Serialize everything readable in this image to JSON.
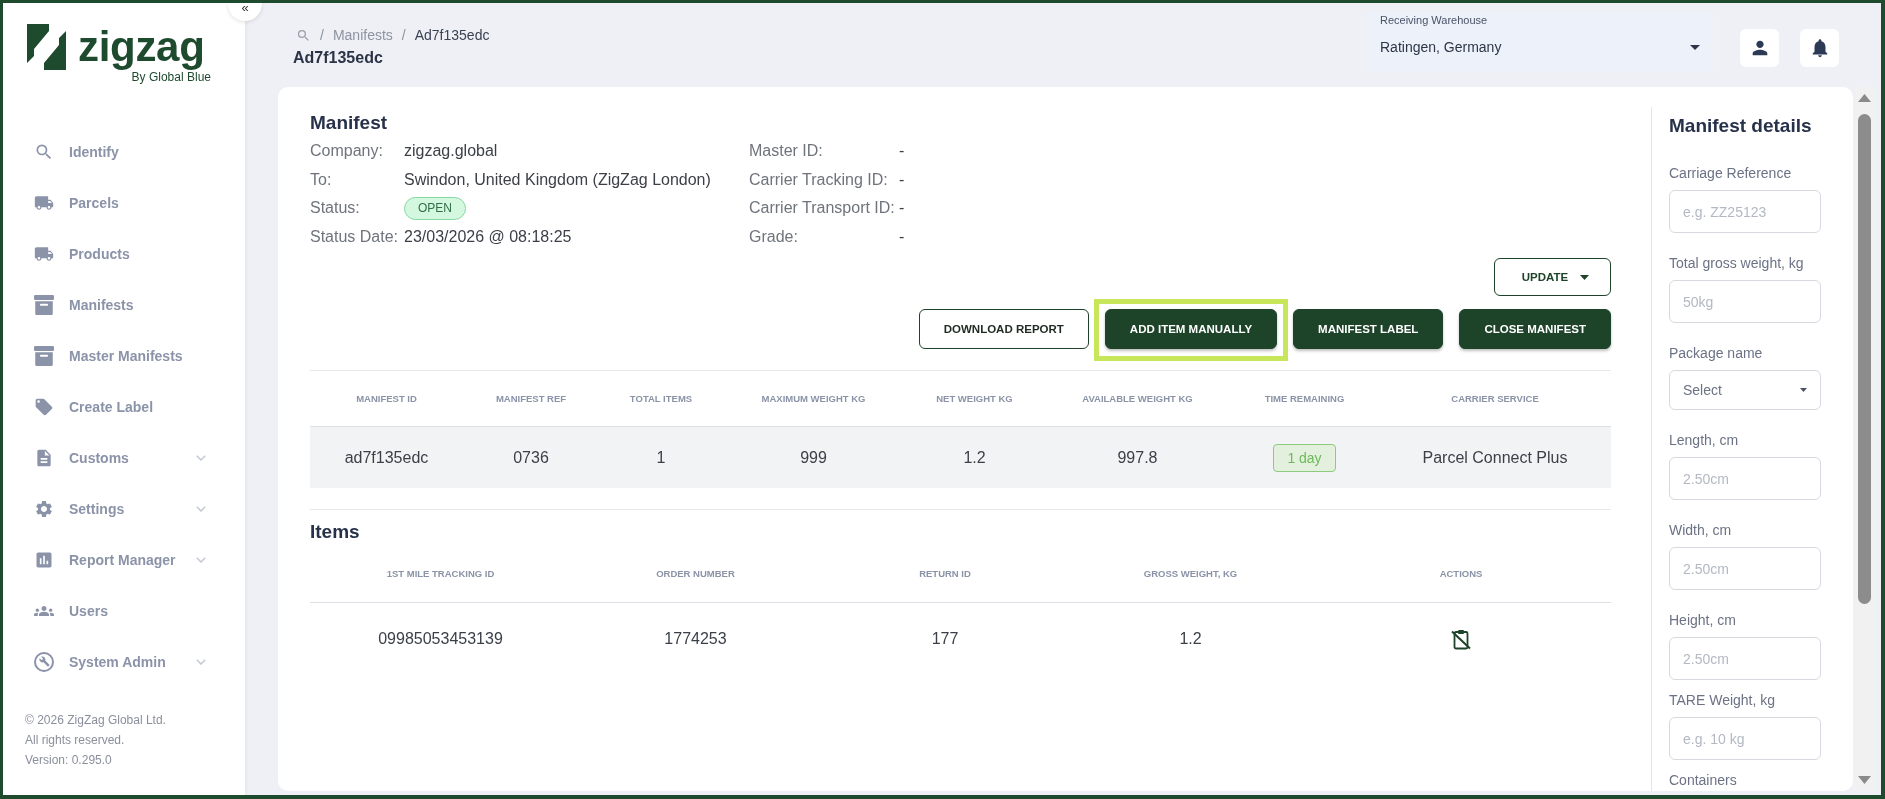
{
  "sidebar": {
    "collapse_label": "«",
    "logo": {
      "wordmark": "zigzag",
      "tagline": "By Global Blue"
    },
    "items": [
      {
        "label": "Identify",
        "has_submenu": false
      },
      {
        "label": "Parcels",
        "has_submenu": false
      },
      {
        "label": "Products",
        "has_submenu": false
      },
      {
        "label": "Manifests",
        "has_submenu": false
      },
      {
        "label": "Master Manifests",
        "has_submenu": false
      },
      {
        "label": "Create Label",
        "has_submenu": false
      },
      {
        "label": "Customs",
        "has_submenu": true
      },
      {
        "label": "Settings",
        "has_submenu": true
      },
      {
        "label": "Report Manager",
        "has_submenu": true
      },
      {
        "label": "Users",
        "has_submenu": false
      },
      {
        "label": "System Admin",
        "has_submenu": true
      }
    ],
    "footer": [
      "© 2026 ZigZag Global Ltd.",
      "All rights reserved.",
      "Version: 0.295.0"
    ]
  },
  "breadcrumb": [
    {
      "separator": "/",
      "label": "Manifests",
      "current": false
    },
    {
      "separator": "/",
      "label": "Ad7f135edc",
      "current": true
    }
  ],
  "page_title": "Ad7f135edc",
  "warehouse_select": {
    "label": "Receiving Warehouse",
    "value": "Ratingen, Germany"
  },
  "manifest": {
    "title": "Manifest",
    "fields": [
      {
        "label": "Company:",
        "value": "zigzag.global",
        "kind": "text"
      },
      {
        "label": "To:",
        "value": "Swindon, United Kingdom (ZigZag London)",
        "kind": "text"
      },
      {
        "label": "Status:",
        "value": "OPEN",
        "kind": "badge"
      },
      {
        "label": "Status Date:",
        "value": "23/03/2026 @ 08:18:25",
        "kind": "text"
      }
    ],
    "carrier_table": {
      "rows": [
        [
          "Master ID:",
          "-"
        ],
        [
          "Carrier Tracking ID:",
          "-"
        ],
        [
          "Carrier Transport ID:",
          "-"
        ],
        [
          "Grade:",
          "-"
        ]
      ]
    },
    "update_button": "UPDATE",
    "actions": [
      {
        "label": "DOWNLOAD REPORT",
        "kind": "outline",
        "highlighted": false
      },
      {
        "label": "ADD ITEM MANUALLY",
        "kind": "primary",
        "highlighted": true
      },
      {
        "label": "MANIFEST LABEL",
        "kind": "primary",
        "highlighted": false
      },
      {
        "label": "CLOSE MANIFEST",
        "kind": "primary",
        "highlighted": false
      }
    ]
  },
  "summary_table": {
    "columns": [
      "MANIFEST ID",
      "MANIFEST REF",
      "TOTAL ITEMS",
      "MAXIMUM WEIGHT KG",
      "NET WEIGHT KG",
      "AVAILABLE WEIGHT KG",
      "TIME REMAINING",
      "CARRIER SERVICE"
    ],
    "rows": [
      {
        "cells": [
          {
            "text": "ad7f135edc",
            "kind": "text"
          },
          {
            "text": "0736",
            "kind": "text"
          },
          {
            "text": "1",
            "kind": "text"
          },
          {
            "text": "999",
            "kind": "text"
          },
          {
            "text": "1.2",
            "kind": "text"
          },
          {
            "text": "997.8",
            "kind": "text"
          },
          {
            "text": "1 day",
            "kind": "badge"
          },
          {
            "text": "Parcel Connect Plus",
            "kind": "text"
          }
        ]
      }
    ]
  },
  "items": {
    "title": "Items",
    "columns": [
      "1ST MILE TRACKING ID",
      "ORDER NUMBER",
      "RETURN ID",
      "GROSS WEIGHT, KG",
      "ACTIONS"
    ],
    "rows": [
      {
        "cells": [
          {
            "text": "09985053453139",
            "kind": "text"
          },
          {
            "text": "1774253",
            "kind": "text"
          },
          {
            "text": "177",
            "kind": "text"
          },
          {
            "text": "1.2",
            "kind": "text"
          },
          {
            "kind": "action"
          }
        ]
      }
    ]
  },
  "details_panel": {
    "title": "Manifest details",
    "fields": [
      {
        "label": "Carriage Reference",
        "kind": "input",
        "placeholder": "e.g. ZZ25123"
      },
      {
        "label": "Total gross weight, kg",
        "kind": "input",
        "placeholder": "50kg"
      },
      {
        "label": "Package name",
        "kind": "select",
        "placeholder": "Select"
      },
      {
        "label": "Length, cm",
        "kind": "input",
        "placeholder": "2.50cm"
      },
      {
        "label": "Width, cm",
        "kind": "input",
        "placeholder": "2.50cm"
      },
      {
        "label": "Height, cm",
        "kind": "input",
        "placeholder": "2.50cm"
      },
      {
        "label": "TARE Weight, kg",
        "kind": "input",
        "placeholder": "e.g. 10 kg"
      },
      {
        "label": "Containers",
        "kind": "label"
      }
    ]
  }
}
